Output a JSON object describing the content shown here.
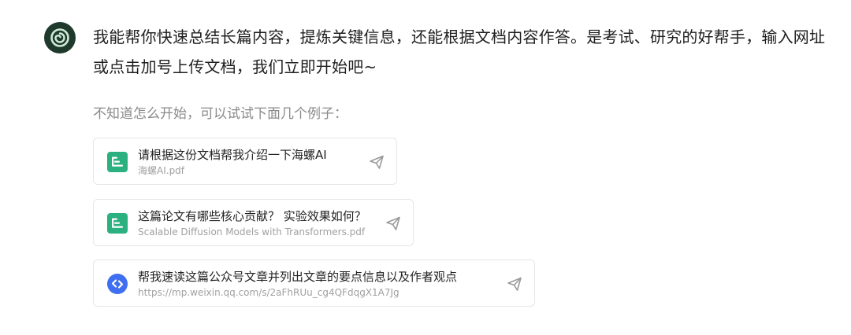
{
  "assistant": {
    "avatar_icon": "snail-logo-icon",
    "intro_text": "我能帮你快速总结长篇内容，提炼关键信息，还能根据文档内容作答。是考试、研究的好帮手，输入网址或点击加号上传文档，我们立即开始吧~"
  },
  "examples": {
    "hint": "不知道怎么开始，可以试试下面几个例子：",
    "items": [
      {
        "icon": "document-icon",
        "title": "请根据这份文档帮我介绍一下海螺AI",
        "subtitle": "海螺AI.pdf",
        "action_icon": "send-icon"
      },
      {
        "icon": "document-icon",
        "title": "这篇论文有哪些核心贡献？ 实验效果如何？",
        "subtitle": "Scalable Diffusion Models with Transformers.pdf",
        "action_icon": "send-icon"
      },
      {
        "icon": "link-icon",
        "title": "帮我速读这篇公众号文章并列出文章的要点信息以及作者观点",
        "subtitle": "https://mp.weixin.qq.com/s/2aFhRUu_cg4QFdqgX1A7Jg",
        "action_icon": "send-icon"
      }
    ]
  },
  "colors": {
    "doc_icon": "#2bb07f",
    "link_icon": "#3f6ff0",
    "avatar_bg": "#1f3a2d"
  }
}
